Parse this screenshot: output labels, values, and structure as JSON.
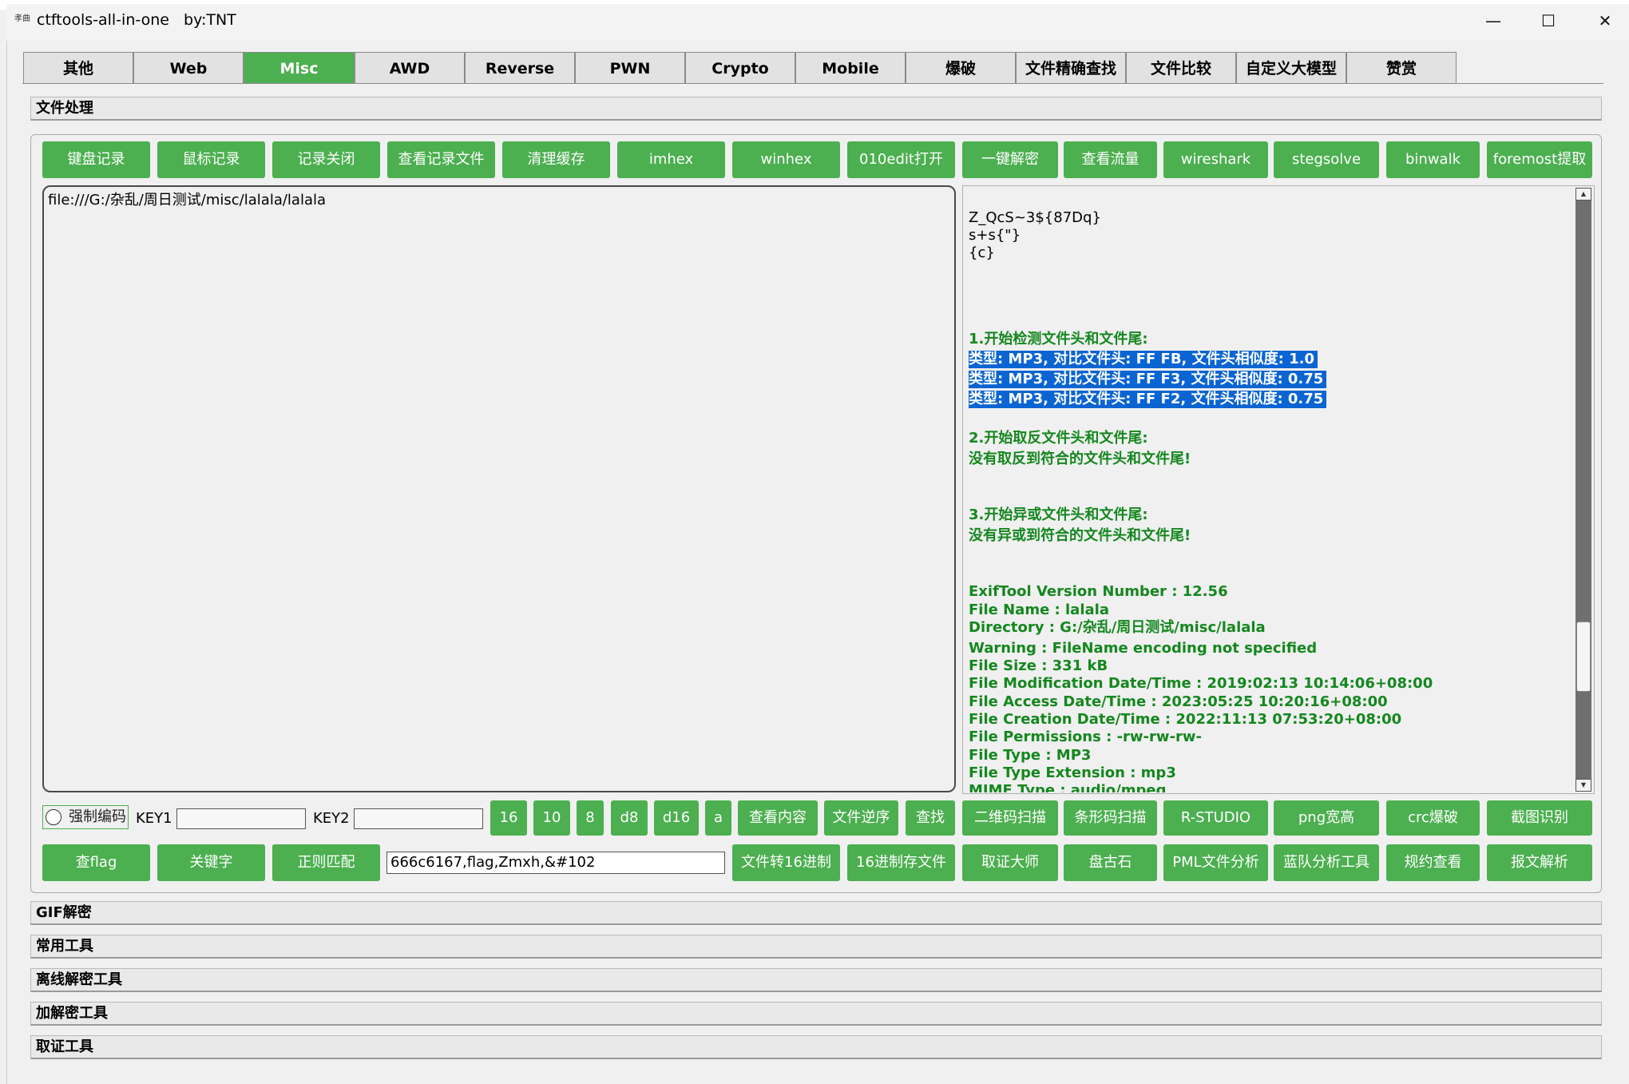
{
  "window": {
    "title": "ctftools-all-in-one   by:TNT",
    "app_icon_text": "孝曲",
    "minimize": "—",
    "maximize": "☐",
    "close": "✕"
  },
  "tabs": [
    {
      "label": "其他"
    },
    {
      "label": "Web"
    },
    {
      "label": "Misc",
      "active": true
    },
    {
      "label": "AWD"
    },
    {
      "label": "Reverse"
    },
    {
      "label": "PWN"
    },
    {
      "label": "Crypto"
    },
    {
      "label": "Mobile"
    },
    {
      "label": "爆破"
    },
    {
      "label": "文件精确查找"
    },
    {
      "label": "文件比较"
    },
    {
      "label": "自定义大模型"
    },
    {
      "label": "赞赏"
    }
  ],
  "sections": {
    "file_processing": "文件处理",
    "gif": "GIF解密",
    "common": "常用工具",
    "offline": "离线解密工具",
    "crypto": "加解密工具",
    "forensics": "取证工具"
  },
  "row1_buttons": [
    "键盘记录",
    "鼠标记录",
    "记录关闭",
    "查看记录文件",
    "清理缓存",
    "imhex",
    "winhex",
    "010edit打开",
    "一键解密",
    "查看流量",
    "wireshark",
    "stegsolve",
    "binwalk",
    "foremost提取"
  ],
  "left_text": "file:///G:/杂乱/周日测试/misc/lalala/lalala",
  "right_output": {
    "raw_lines": [
      "Z_QcS~3${87Dq}",
      "s+s{\"}",
      "{c}"
    ],
    "step1_title": "1.开始检测文件头和文件尾:",
    "step1_results": [
      "类型: MP3, 对比文件头: FF FB, 文件头相似度: 1.0",
      "类型: MP3, 对比文件头: FF F3, 文件头相似度: 0.75",
      "类型: MP3, 对比文件头: FF F2, 文件头相似度: 0.75"
    ],
    "step2_title": "2.开始取反文件头和文件尾:",
    "step2_result": "没有取反到符合的文件头和文件尾!",
    "step3_title": "3.开始异或文件头和文件尾:",
    "step3_result": "没有异或到符合的文件头和文件尾!",
    "exif": [
      "ExifTool Version Number : 12.56",
      "File Name : lalala",
      "Directory : G:/杂乱/周日测试/misc/lalala",
      "Warning : FileName encoding not specified",
      "File Size : 331 kB",
      "File Modification Date/Time : 2019:02:13 10:14:06+08:00",
      "File Access Date/Time : 2023:05:25 10:20:16+08:00",
      "File Creation Date/Time : 2022:11:13 07:53:20+08:00",
      "File Permissions : -rw-rw-rw-",
      "File Type : MP3",
      "File Type Extension : mp3",
      "MIME Type : audio/mpeg"
    ]
  },
  "row2": {
    "force_encoding_label": "强制编码",
    "key1_label": "KEY1",
    "key2_label": "KEY2",
    "key1_value": "",
    "key2_value": "",
    "buttons": [
      "16",
      "10",
      "8",
      "d8",
      "d16",
      "a",
      "查看内容",
      "文件逆序",
      "查找",
      "二维码扫描",
      "条形码扫描",
      "R-STUDIO",
      "png宽高",
      "crc爆破",
      "截图识别"
    ]
  },
  "row3": {
    "left_buttons": [
      "查flag",
      "关键字",
      "正则匹配"
    ],
    "search_value": "666c6167,flag,Zmxh,&#102",
    "right_buttons": [
      "文件转16进制",
      "16进制存文件",
      "取证大师",
      "盘古石",
      "PML文件分析",
      "蓝队分析工具",
      "规约查看",
      "报文解析"
    ]
  },
  "colors": {
    "accent_green": "#4caf50",
    "output_green": "#14871e",
    "selection_blue": "#0a64d2"
  }
}
